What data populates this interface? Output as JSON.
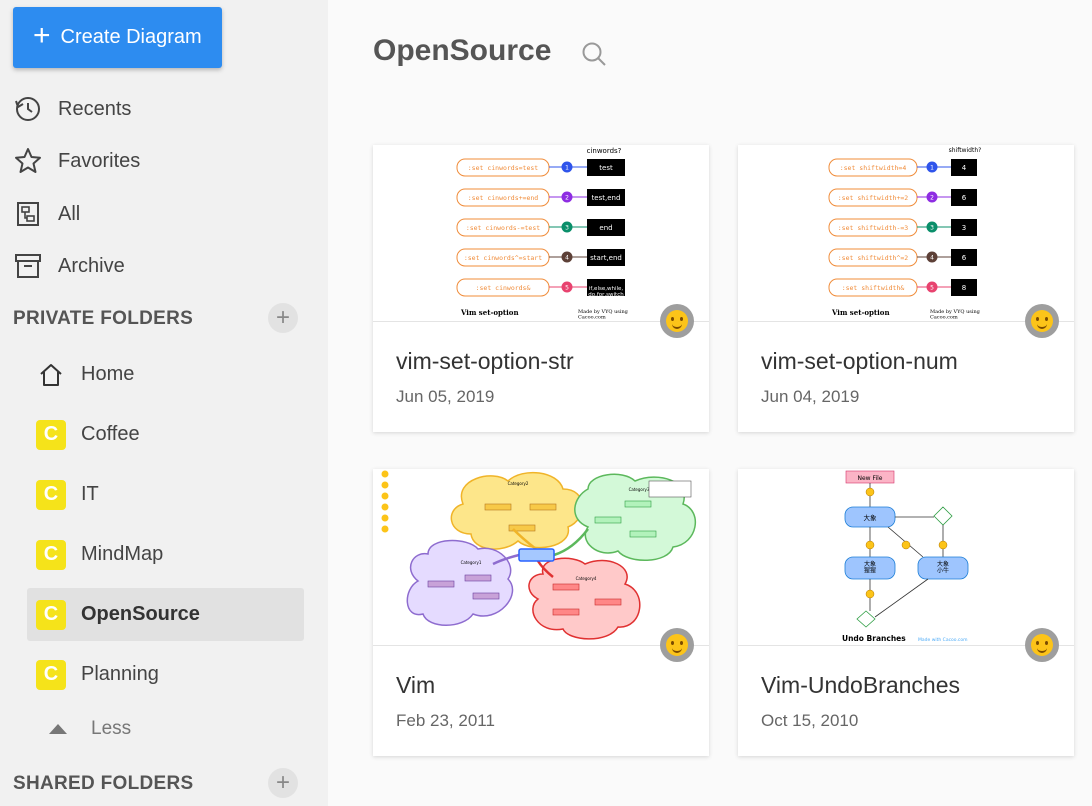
{
  "sidebar": {
    "create_label": "Create Diagram",
    "nav": [
      {
        "label": "Recents",
        "icon": "history-icon"
      },
      {
        "label": "Favorites",
        "icon": "star-icon"
      },
      {
        "label": "All",
        "icon": "diagram-icon"
      },
      {
        "label": "Archive",
        "icon": "archive-icon"
      }
    ],
    "private_header": "PRIVATE FOLDERS",
    "folders": [
      {
        "label": "Home",
        "icon": "home-icon"
      },
      {
        "label": "Coffee",
        "icon": "folder-badge-icon"
      },
      {
        "label": "IT",
        "icon": "folder-badge-icon"
      },
      {
        "label": "MindMap",
        "icon": "folder-badge-icon"
      },
      {
        "label": "OpenSource",
        "icon": "folder-badge-icon",
        "active": true
      },
      {
        "label": "Planning",
        "icon": "folder-badge-icon"
      }
    ],
    "less_label": "Less",
    "shared_header": "SHARED FOLDERS",
    "badge_letter": "C"
  },
  "main": {
    "title": "OpenSource",
    "cards": [
      {
        "name": "vim-set-option-str",
        "date": "Jun 05, 2019",
        "thumb": {
          "question": "cinwords?",
          "rows": [
            {
              "cmd": ":set cinwords=test",
              "num": "1",
              "result": "test",
              "color": "#2f54eb"
            },
            {
              "cmd": ":set cinwords+=end",
              "num": "2",
              "result": "test,end",
              "color": "#8e2de2"
            },
            {
              "cmd": ":set cinwords-=test",
              "num": "3",
              "result": "end",
              "color": "#0a8f6a"
            },
            {
              "cmd": ":set cinwords^=start",
              "num": "4",
              "result": "start,end",
              "color": "#5d4037"
            },
            {
              "cmd": ":set cinwords&",
              "num": "5",
              "result": "if,else,while,\ndo,for,switch",
              "color": "#e8436f"
            }
          ],
          "footer_title": "Vim set-option",
          "footer_credit": "Made by VYQ using\nCacoo.com"
        }
      },
      {
        "name": "vim-set-option-num",
        "date": "Jun 04, 2019",
        "thumb": {
          "question": "shiftwidth?",
          "rows": [
            {
              "cmd": ":set shiftwidth=4",
              "num": "1",
              "result": "4",
              "color": "#2f54eb"
            },
            {
              "cmd": ":set shiftwidth+=2",
              "num": "2",
              "result": "6",
              "color": "#8e2de2"
            },
            {
              "cmd": ":set shiftwidth-=3",
              "num": "3",
              "result": "3",
              "color": "#0a8f6a"
            },
            {
              "cmd": ":set shiftwidth^=2",
              "num": "4",
              "result": "6",
              "color": "#5d4037"
            },
            {
              "cmd": ":set shiftwidth&",
              "num": "5",
              "result": "8",
              "color": "#e8436f"
            }
          ],
          "footer_title": "Vim set-option",
          "footer_credit": "Made by VYQ using\nCacoo.com"
        }
      },
      {
        "name": "Vim",
        "date": "Feb 23, 2011",
        "thumb": {
          "cat1": "Category1",
          "cat2": "Category2",
          "cat3": "Category3",
          "cat4": "Category4"
        }
      },
      {
        "name": "Vim-UndoBranches",
        "date": "Oct 15, 2010",
        "thumb": {
          "new_file": "New File",
          "node_a": "大象",
          "node_b": "大象\n猩猩",
          "node_c": "大象\n小牛",
          "footer_title": "Undo Branches",
          "footer_credit": "Made with Cacoo.com"
        }
      }
    ]
  },
  "colors": {
    "accent": "#2d8cf0",
    "folder_badge": "#f5e31a",
    "sidebar_bg": "#f1f1f1"
  }
}
